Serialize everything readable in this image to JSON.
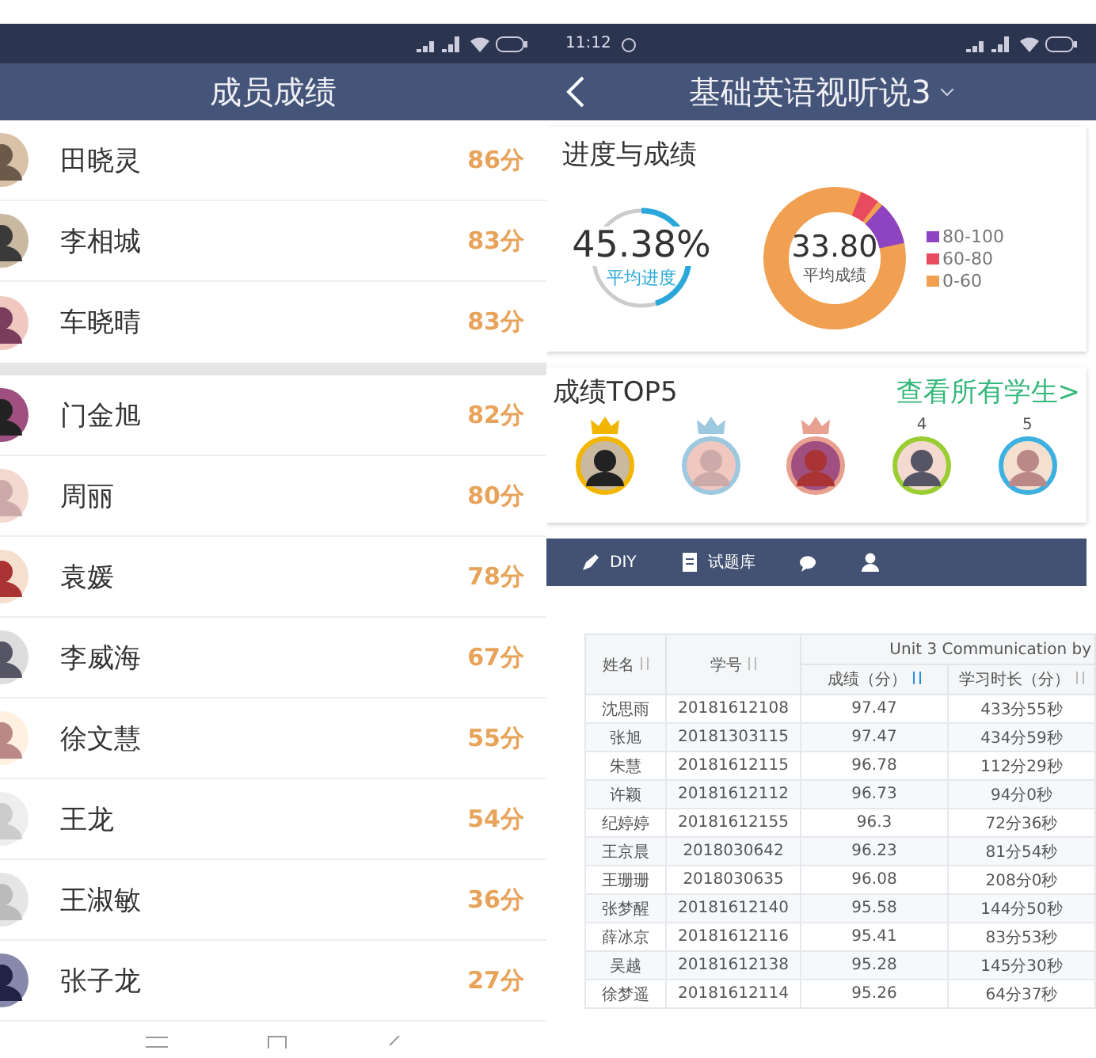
{
  "member_scores": {
    "title": "成员成绩",
    "members": [
      {
        "name": "田晓灵",
        "score": "86分",
        "group_end": false
      },
      {
        "name": "李相城",
        "score": "83分",
        "group_end": false
      },
      {
        "name": "车晓晴",
        "score": "83分",
        "group_end": true
      },
      {
        "name": "门金旭",
        "score": "82分",
        "group_end": false
      },
      {
        "name": "周丽",
        "score": "80分",
        "group_end": false
      },
      {
        "name": "袁媛",
        "score": "78分",
        "group_end": false
      },
      {
        "name": "李威海",
        "score": "67分",
        "group_end": false
      },
      {
        "name": "徐文慧",
        "score": "55分",
        "group_end": false
      },
      {
        "name": "王龙",
        "score": "54分",
        "group_end": false
      },
      {
        "name": "王淑敏",
        "score": "36分",
        "group_end": false
      },
      {
        "name": "张子龙",
        "score": "27分",
        "group_end": false
      }
    ]
  },
  "course": {
    "status_bar": {
      "time": "11:12"
    },
    "title": "基础英语视听说3",
    "progress_card": {
      "title": "进度与成绩",
      "progress": {
        "value": "45.38%",
        "label": "平均进度"
      },
      "average": {
        "value": "33.80",
        "label": "平均成绩"
      },
      "legend": [
        {
          "label": "80-100",
          "color": "#8e44c0"
        },
        {
          "label": "60-80",
          "color": "#e84a5f"
        },
        {
          "label": "0-60",
          "color": "#f0a050"
        }
      ]
    },
    "top5": {
      "title": "成绩TOP5",
      "link": "查看所有学生>",
      "students": [
        {
          "kind": "crown",
          "color": "#f2b600"
        },
        {
          "kind": "crown",
          "color": "#9cc8e0"
        },
        {
          "kind": "crown",
          "color": "#e8a090"
        },
        {
          "kind": "rank",
          "rank": "4",
          "color": "#9acd32"
        },
        {
          "kind": "rank",
          "rank": "5",
          "color": "#3cb0e0"
        }
      ]
    },
    "tabs": [
      {
        "kind": "diy",
        "label": "DIY"
      },
      {
        "kind": "bank",
        "label": "试题库"
      },
      {
        "kind": "chat"
      },
      {
        "kind": "person"
      }
    ]
  },
  "table": {
    "columns": [
      {
        "label": "姓名",
        "sorted": false
      },
      {
        "label": "学号",
        "sorted": false
      }
    ],
    "group": {
      "title": "Unit 3 Communication by",
      "columns": [
        {
          "label": "成绩（分）",
          "sorted": true
        },
        {
          "label": "学习时长（分）",
          "sorted": false
        }
      ]
    },
    "rows": [
      [
        "沈思雨",
        "20181612108",
        "97.47",
        "433分55秒"
      ],
      [
        "张旭",
        "20181303115",
        "97.47",
        "434分59秒"
      ],
      [
        "朱慧",
        "20181612115",
        "96.78",
        "112分29秒"
      ],
      [
        "许颖",
        "20181612112",
        "96.73",
        "94分0秒"
      ],
      [
        "纪婷婷",
        "20181612155",
        "96.3",
        "72分36秒"
      ],
      [
        "王京晨",
        "2018030642",
        "96.23",
        "81分54秒"
      ],
      [
        "王珊珊",
        "2018030635",
        "96.08",
        "208分0秒"
      ],
      [
        "张梦醒",
        "20181612140",
        "95.58",
        "144分50秒"
      ],
      [
        "薛冰京",
        "20181612116",
        "95.41",
        "83分53秒"
      ],
      [
        "吴越",
        "20181612138",
        "95.28",
        "145分30秒"
      ],
      [
        "徐梦遥",
        "20181612114",
        "95.26",
        "64分37秒"
      ]
    ]
  }
}
